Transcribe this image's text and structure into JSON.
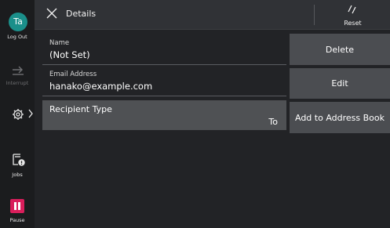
{
  "rail": {
    "avatar_initials": "Ta",
    "logout_label": "Log Out",
    "interrupt_label": "Interrupt",
    "jobs_label": "Jobs",
    "pause_label": "Pause"
  },
  "header": {
    "title": "Details",
    "reset_label": "Reset"
  },
  "fields": {
    "name_label": "Name",
    "name_value": "(Not Set)",
    "email_label": "Email Address",
    "email_value": "hanako@example.com"
  },
  "recipient": {
    "label": "Recipient Type",
    "value": "To"
  },
  "actions": {
    "delete_label": "Delete",
    "edit_label": "Edit",
    "add_label": "Add to Address Book"
  },
  "colors": {
    "background": "#222326",
    "header": "#303236",
    "avatar": "#1b8f8a",
    "pause": "#d91e5b",
    "button": "#4b4d51",
    "selected_row": "#4f5154"
  }
}
